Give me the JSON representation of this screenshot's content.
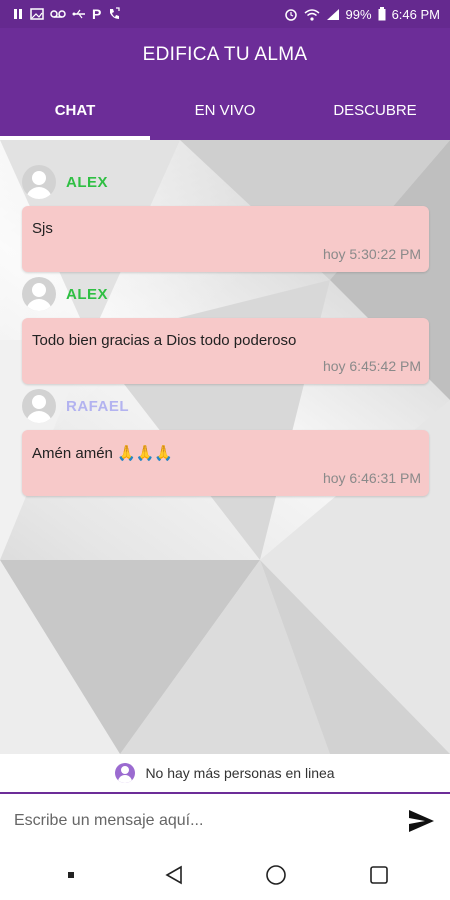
{
  "status_bar": {
    "battery": "99%",
    "time": "6:46 PM",
    "left_icons": [
      "pause-icon",
      "image-icon",
      "voicemail-icon",
      "usb-icon",
      "p-app-icon",
      "phone-forward-icon"
    ],
    "right_icons": [
      "alarm-icon",
      "wifi-icon",
      "signal-icon",
      "battery-icon"
    ]
  },
  "app": {
    "title": "EDIFICA TU ALMA",
    "tabs": [
      {
        "label": "CHAT",
        "active": true
      },
      {
        "label": "EN VIVO",
        "active": false
      },
      {
        "label": "DESCUBRE",
        "active": false
      }
    ]
  },
  "messages": [
    {
      "author": "ALEX",
      "author_color": "#2fbf43",
      "text": "Sjs",
      "time": "hoy 5:30:22 PM"
    },
    {
      "author": "ALEX",
      "author_color": "#2fbf43",
      "text": "Todo bien gracias a Dios todo poderoso",
      "time": "hoy 6:45:42 PM"
    },
    {
      "author": "RAFAEL",
      "author_color": "#b3b3f0",
      "text": "Amén amén 🙏🙏🙏",
      "time": "hoy 6:46:31 PM"
    }
  ],
  "online_status": "No hay más personas en linea",
  "composer": {
    "placeholder": "Escribe un mensaje aquí...",
    "send_icon": "send-icon"
  },
  "colors": {
    "primary": "#6c2d98",
    "bubble": "#f7c9c9"
  }
}
